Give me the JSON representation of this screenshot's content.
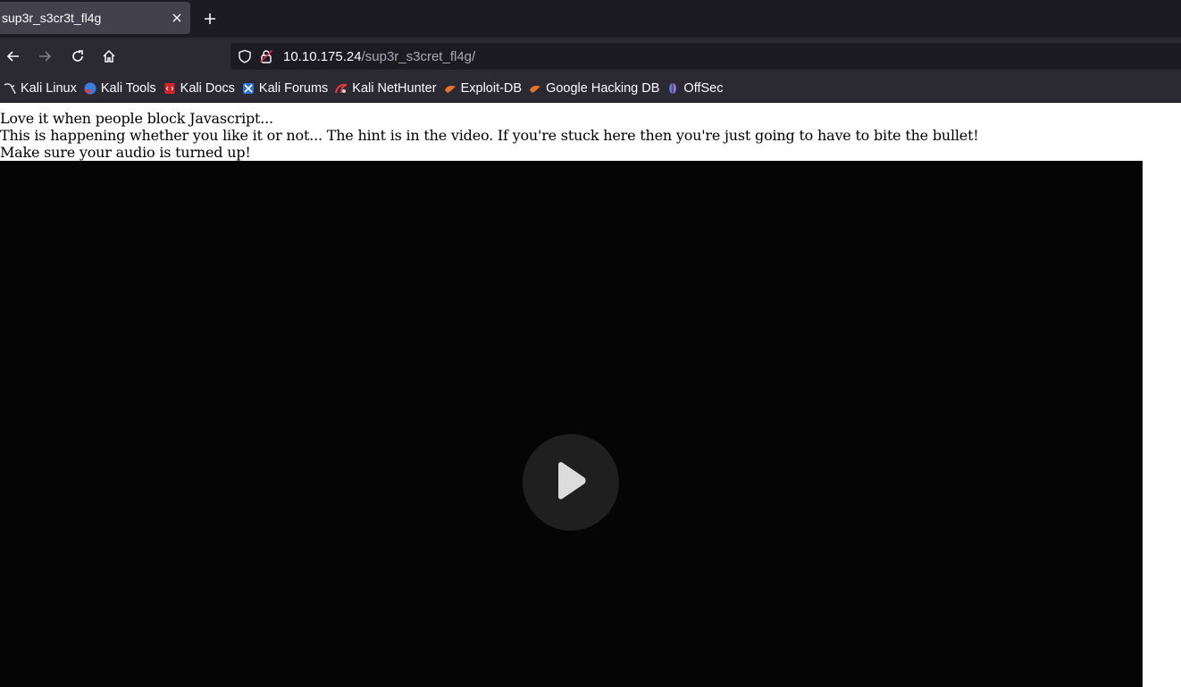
{
  "browser": {
    "tab": {
      "title": "sup3r_s3cr3t_fl4g"
    },
    "url": {
      "host": "10.10.175.24",
      "path": "/sup3r_s3cret_fl4g/"
    },
    "bookmarks": [
      {
        "label": "Kali Linux",
        "icon": "kali-dragon-icon"
      },
      {
        "label": "Kali Tools",
        "icon": "kali-tools-icon"
      },
      {
        "label": "Kali Docs",
        "icon": "kali-docs-icon"
      },
      {
        "label": "Kali Forums",
        "icon": "kali-forums-icon"
      },
      {
        "label": "Kali NetHunter",
        "icon": "kali-nethunter-icon"
      },
      {
        "label": "Exploit-DB",
        "icon": "exploit-db-icon"
      },
      {
        "label": "Google Hacking DB",
        "icon": "google-hacking-db-icon"
      },
      {
        "label": "OffSec",
        "icon": "offsec-icon"
      }
    ]
  },
  "page": {
    "lines": [
      "Love it when people block Javascript...",
      "This is happening whether you like it or not... The hint is in the video. If you're stuck here then you're just going to have to bite the bullet!",
      "Make sure your audio is turned up!"
    ]
  },
  "colors": {
    "tabstrip": "#1c1b22",
    "toolbar": "#2b2a33",
    "active_tab": "#42414d",
    "video_bg": "#050505",
    "play_button": "#1f1f1f"
  }
}
